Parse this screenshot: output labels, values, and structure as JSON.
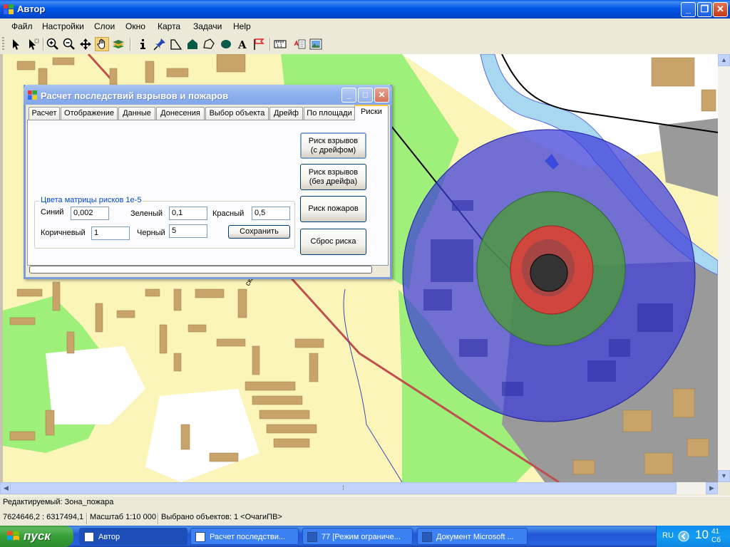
{
  "window": {
    "title": "Автор"
  },
  "menu": [
    "Файл",
    "Настройки",
    "Слои",
    "Окно",
    "Карта",
    "Задачи",
    "Help"
  ],
  "toolbar_icons": [
    "arrow-select-icon",
    "multi-select-icon",
    "zoom-in-icon",
    "zoom-out-icon",
    "pan-arrows-icon",
    "hand-icon",
    "layers-icon",
    "info-icon",
    "pin-icon",
    "polyline-icon",
    "polygon-icon",
    "polygon-outline-icon",
    "ellipse-icon",
    "text-icon",
    "flag-icon",
    "ruler-icon",
    "properties-icon",
    "image-icon"
  ],
  "map": {
    "street_label": "ская"
  },
  "dialog": {
    "title": "Расчет последствий взрывов и пожаров",
    "tabs": [
      "Расчет",
      "Отображение",
      "Данные",
      "Донесения",
      "Выбор объекта",
      "Дрейф",
      "По площади",
      "Риски"
    ],
    "active_tab": "Риски",
    "buttons": {
      "risk_explosion_drift": "Риск взрывов\n(с дрейфом)",
      "risk_explosion_nodrift": "Риск взрывов\n(без дрейфа)",
      "risk_fire": "Риск пожаров",
      "reset_risk": "Сброс риска",
      "save": "Сохранить"
    },
    "group_title": "Цвета матрицы рисков 1е-5",
    "fields": {
      "blue_label": "Синий",
      "blue_value": "0,002",
      "green_label": "Зеленый",
      "green_value": "0,1",
      "red_label": "Красный",
      "red_value": "0,5",
      "brown_label": "Коричневый",
      "brown_value": "1",
      "black_label": "Черный",
      "black_value": "5"
    },
    "progress": 0
  },
  "status": {
    "editable": "Редактируемый: Зона_пожара",
    "coords": "7624646,2 : 6317494,1",
    "scale": "Масштаб 1:10 000",
    "selected": "Выбрано объектов: 1 <ОчагиПВ>"
  },
  "taskbar": {
    "start": "пуск",
    "tasks": [
      "Автор",
      "Расчет последстви...",
      "77 [Режим ограниче...",
      "Документ Microsoft ..."
    ],
    "lang": "RU",
    "time": "10",
    "time_minutes": "41",
    "day": "Сб"
  },
  "colors": {
    "risk_blue": "#3B3BDA",
    "risk_green": "#4C9A3A",
    "risk_red": "#E8393A",
    "risk_brown": "#8A4A3A",
    "risk_black": "#333333",
    "map_bg": "#FCF5BA",
    "park": "#9EF07A",
    "water": "#A8D8F0",
    "building": "#C9A46A"
  }
}
